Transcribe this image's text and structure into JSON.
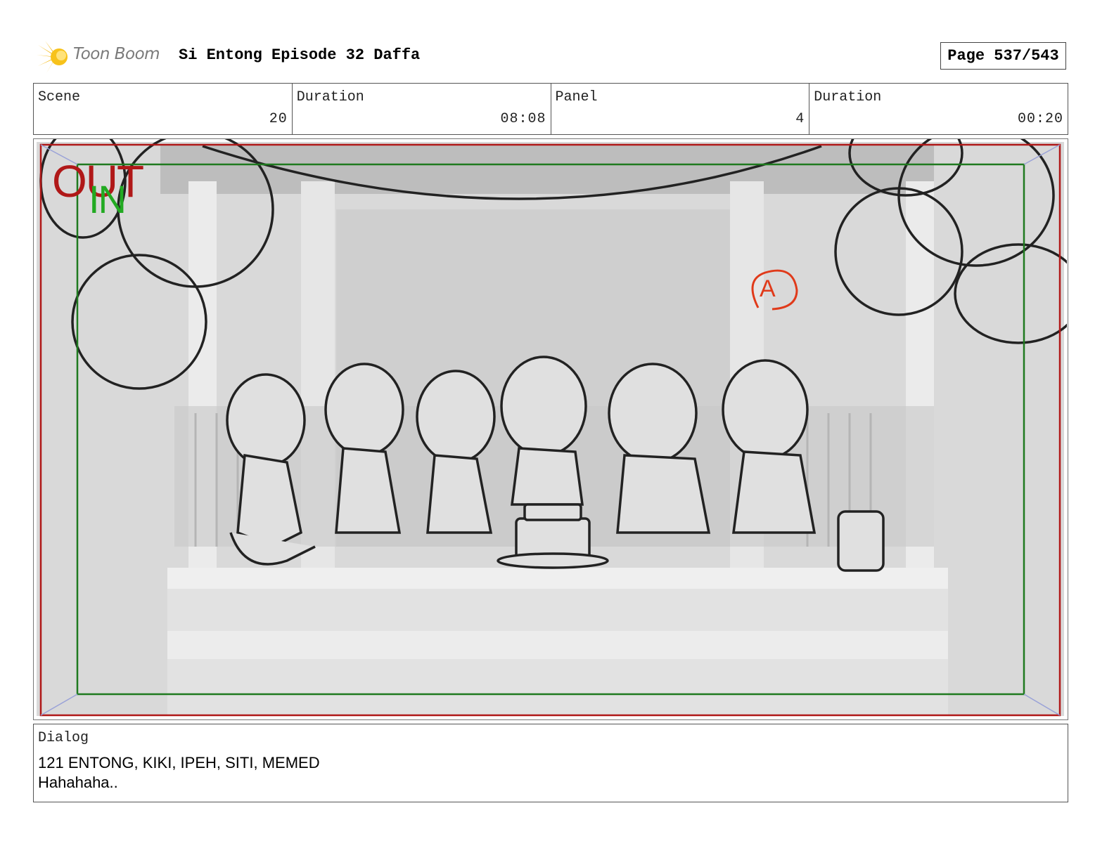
{
  "header": {
    "logo_text": "Toon Boom",
    "project_title": "Si Entong Episode 32 Daffa",
    "page_label": "Page 537/543"
  },
  "info": {
    "scene_label": "Scene",
    "scene_value": "20",
    "scene_duration_label": "Duration",
    "scene_duration_value": "08:08",
    "panel_label": "Panel",
    "panel_value": "4",
    "panel_duration_label": "Duration",
    "panel_duration_value": "00:20"
  },
  "panel": {
    "out_marker": "OUT",
    "in_marker": "IN",
    "camera_marker": "A",
    "colors": {
      "out_frame": "#b01818",
      "in_frame": "#1f7a1f",
      "in_text": "#22aa22",
      "camera_mark": "#e03a1a"
    }
  },
  "dialog": {
    "label": "Dialog",
    "line1": "121 ENTONG, KIKI, IPEH, SITI, MEMED",
    "line2": "Hahahaha.."
  }
}
